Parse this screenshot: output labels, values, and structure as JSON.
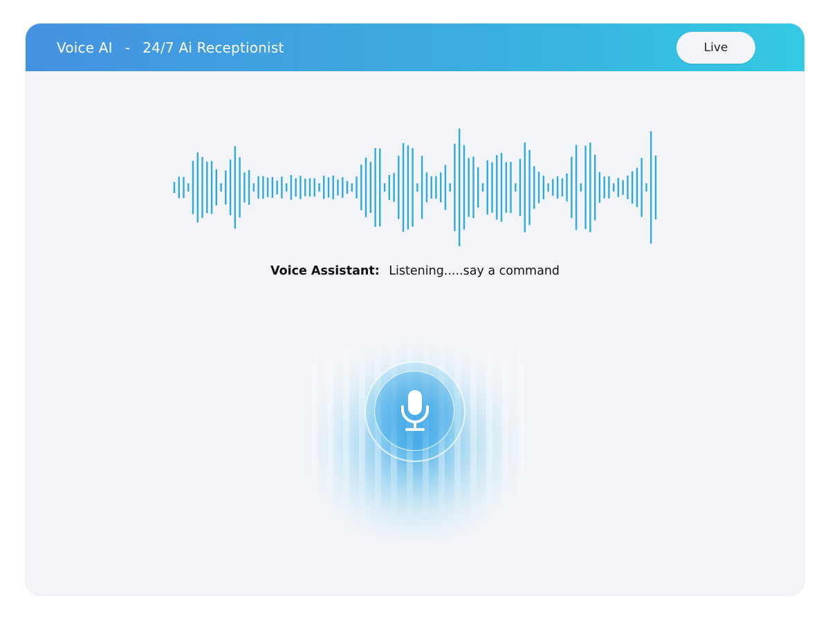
{
  "header": {
    "app_name": "Voice AI",
    "separator": "-",
    "subtitle": "24/7 Ai Receptionist",
    "live_label": "Live"
  },
  "status": {
    "label": "Voice Assistant:",
    "message": "Listening.....say  a command"
  },
  "colors": {
    "header_gradient": [
      "#4592e0",
      "#3cacdf",
      "#33c9e3"
    ],
    "waveform": "#2ea8e0",
    "background": "#f2f4f8"
  },
  "icons": {
    "mic": "microphone-icon"
  }
}
